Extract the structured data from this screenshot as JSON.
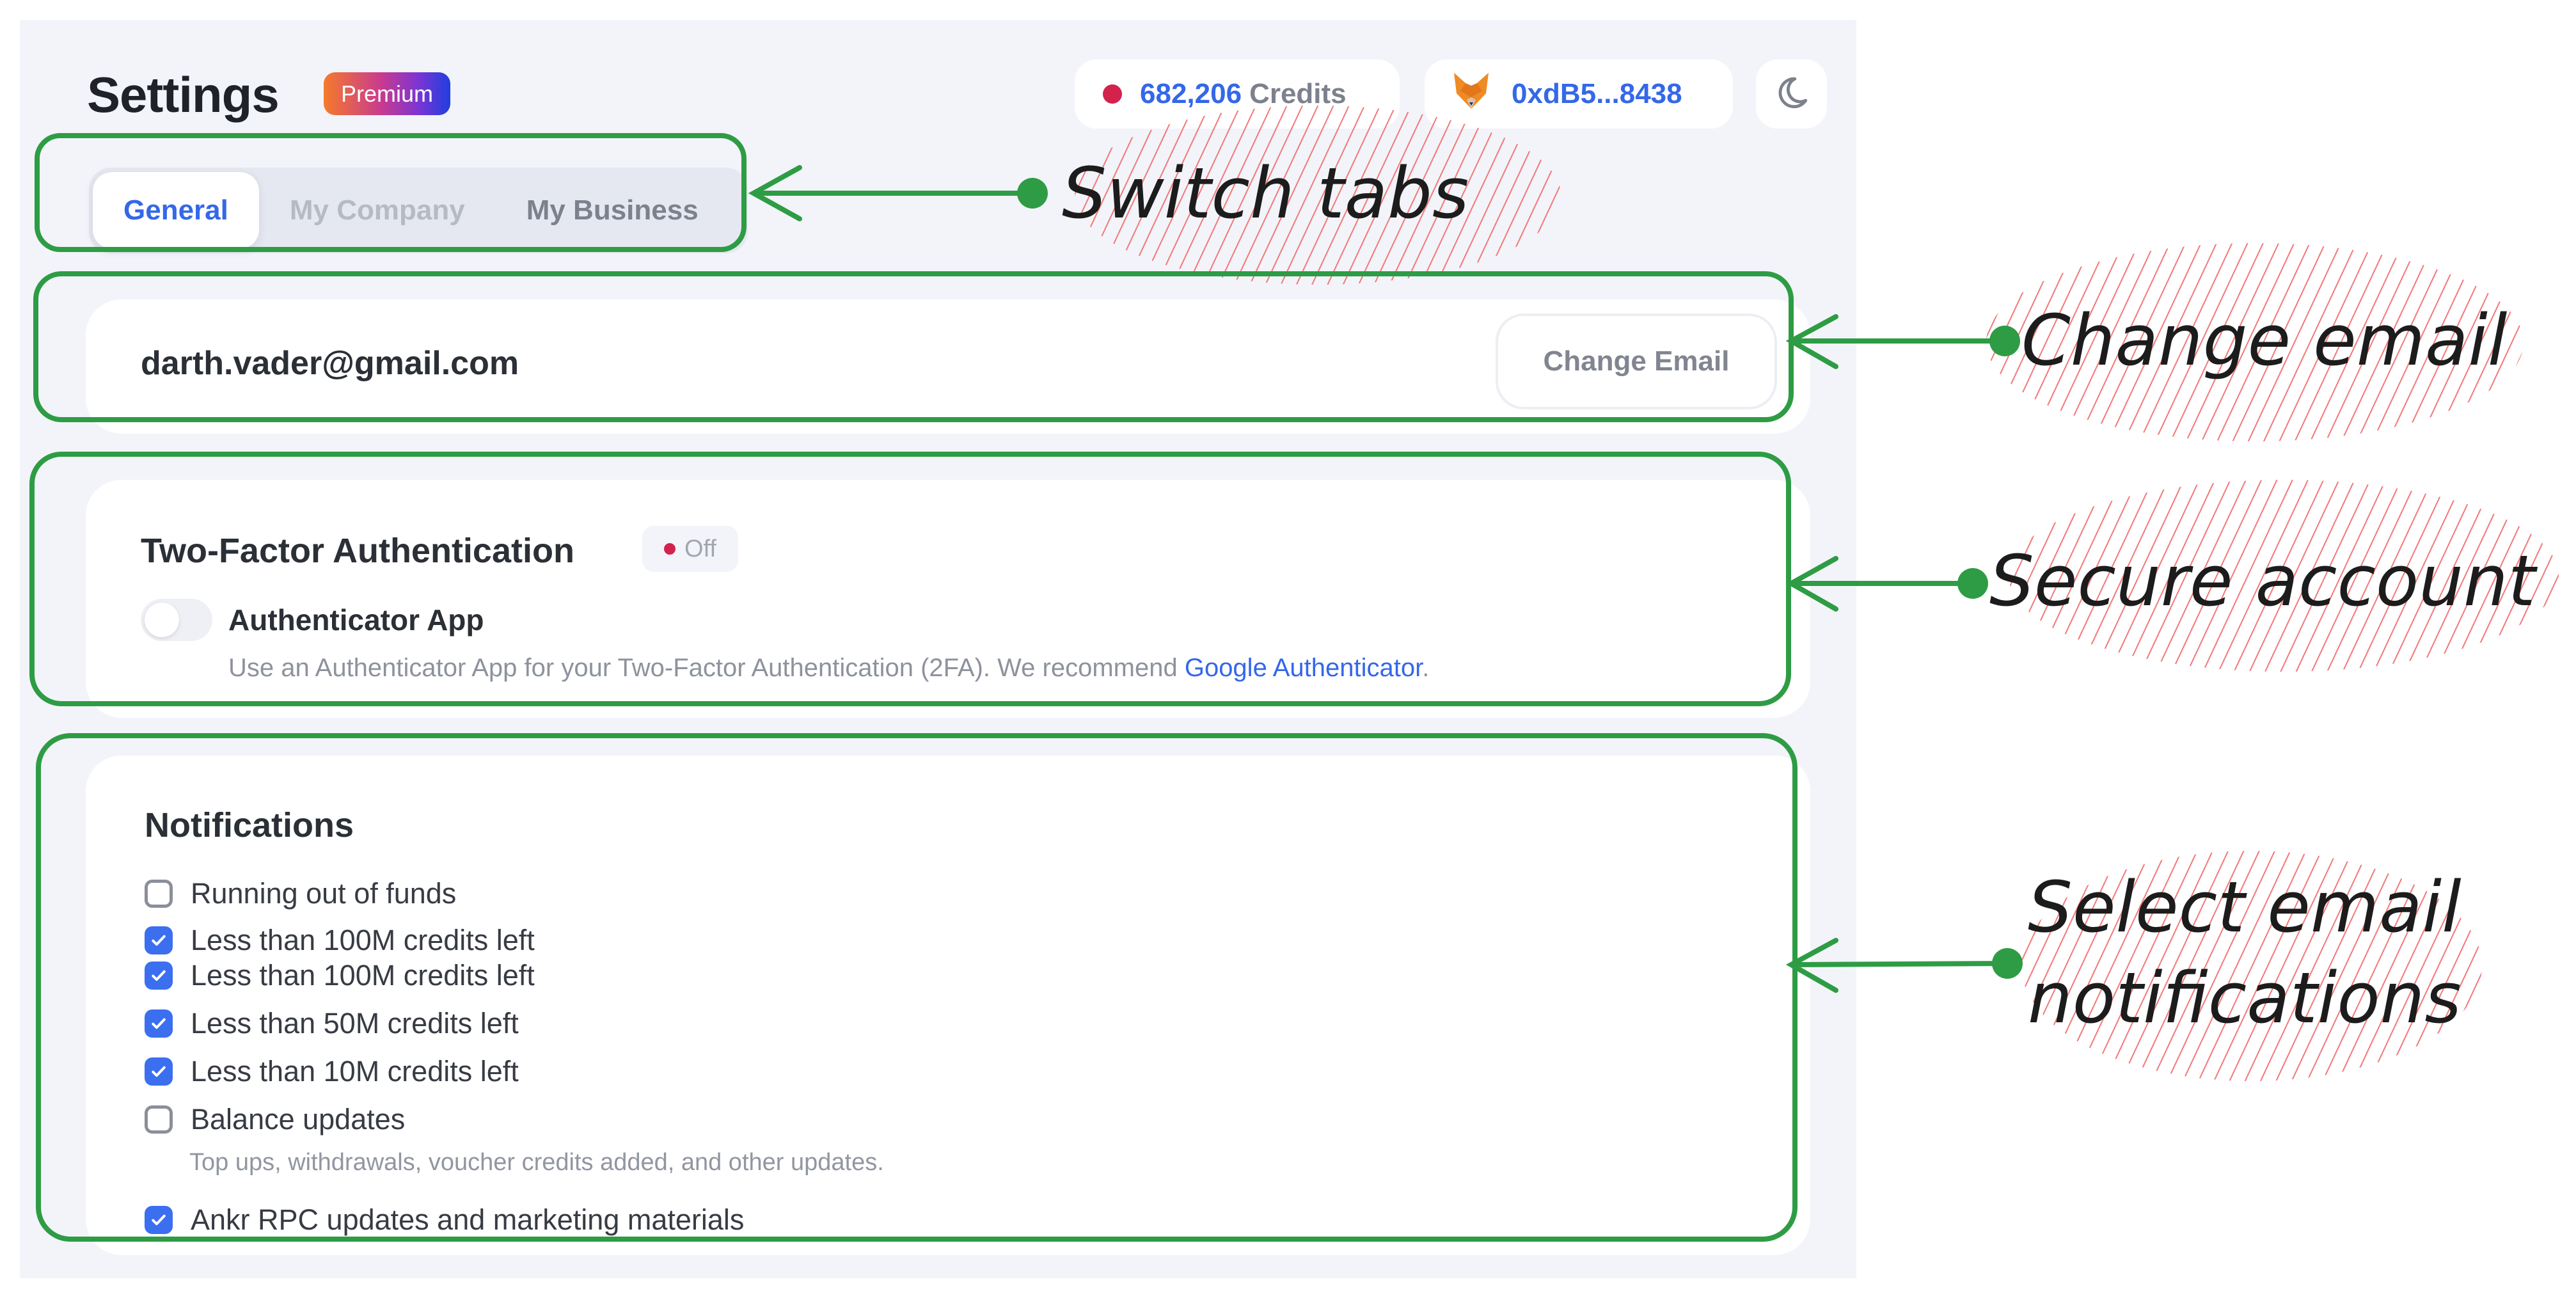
{
  "header": {
    "title": "Settings",
    "plan_badge": "Premium",
    "credits": {
      "status_icon": "status-dot-icon",
      "amount": "682,206",
      "label": "Credits",
      "status_color": "#d3224c"
    },
    "wallet": {
      "icon": "metamask-fox-icon",
      "address": "0xdB5...8438"
    },
    "theme_toggle_icon": "moon-icon"
  },
  "tabs": [
    {
      "label": "General",
      "state": "active"
    },
    {
      "label": "My Company",
      "state": "disabled"
    },
    {
      "label": "My Business",
      "state": "inactive"
    }
  ],
  "email_section": {
    "email": "darth.vader@gmail.com",
    "change_button": "Change Email"
  },
  "two_factor": {
    "title": "Two-Factor Authentication",
    "status": "Off",
    "status_color": "#d3224c",
    "app_label": "Authenticator App",
    "app_enabled": false,
    "description": "Use an Authenticator App for your Two-Factor Authentication (2FA). We recommend ",
    "link_text": "Google Authenticator",
    "description_end": "."
  },
  "notifications": {
    "title": "Notifications",
    "items": [
      {
        "label": "Running out of funds",
        "checked": false
      },
      {
        "label": "Less than 100M credits left",
        "checked": true
      },
      {
        "label": "Less than 100M credits left",
        "checked": true
      },
      {
        "label": "Less than 50M credits left",
        "checked": true
      },
      {
        "label": "Less than 10M credits left",
        "checked": true
      },
      {
        "label": "Balance updates",
        "checked": false,
        "sublabel": "Top ups, withdrawals, voucher credits added, and other updates."
      },
      {
        "label": "Ankr RPC updates and marketing materials",
        "checked": true
      }
    ]
  },
  "annotations": [
    {
      "text": "Switch tabs"
    },
    {
      "text": "Change email"
    },
    {
      "text": "Secure account"
    },
    {
      "text": "Select email",
      "text2": "notifications"
    }
  ],
  "colors": {
    "accent": "#3468e8",
    "annotation_green": "#2e9c44",
    "annotation_hatch": "#f27878",
    "panel_bg": "#f2f4f9"
  }
}
